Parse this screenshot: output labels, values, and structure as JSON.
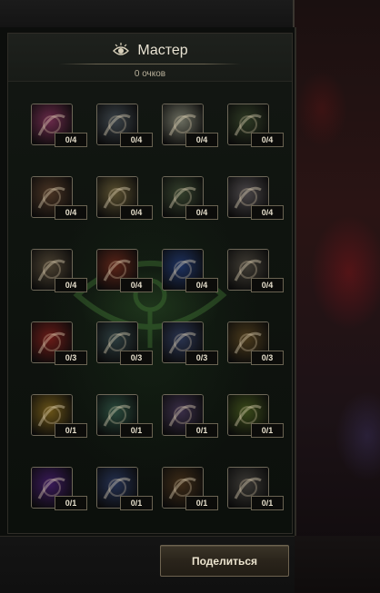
{
  "panel": {
    "title": "Мастер",
    "points_label": "0 очков"
  },
  "skills": [
    {
      "icon": "red-beast-skill-icon",
      "level": "0/4",
      "color": "#6a2a4a"
    },
    {
      "icon": "scattered-shards-skill-icon",
      "level": "0/4",
      "color": "#3a4248"
    },
    {
      "icon": "armored-knight-skill-icon",
      "level": "0/4",
      "color": "#6c6e60"
    },
    {
      "icon": "green-emblem-skill-icon",
      "level": "0/4",
      "color": "#2e3a24"
    },
    {
      "icon": "spear-thrust-skill-icon",
      "level": "0/4",
      "color": "#4a3424"
    },
    {
      "icon": "golden-strike-skill-icon",
      "level": "0/4",
      "color": "#5a5030"
    },
    {
      "icon": "forest-spirit-skill-icon",
      "level": "0/4",
      "color": "#34402c"
    },
    {
      "icon": "shield-sword-skill-icon",
      "level": "0/4",
      "color": "#4a4648"
    },
    {
      "icon": "bronze-cross-rune-skill-icon",
      "level": "0/4",
      "color": "#4a4030"
    },
    {
      "icon": "crimson-rune-skill-icon",
      "level": "0/4",
      "color": "#5a2418"
    },
    {
      "icon": "blue-red-sigil-skill-icon",
      "level": "0/4",
      "color": "#1e3260"
    },
    {
      "icon": "clover-seal-skill-icon",
      "level": "0/4",
      "color": "#403c34"
    },
    {
      "icon": "red-slash-skill-icon",
      "level": "0/3",
      "color": "#6a1c18"
    },
    {
      "icon": "whirlwind-skill-icon",
      "level": "0/3",
      "color": "#2c3c3e"
    },
    {
      "icon": "blade-throw-skill-icon",
      "level": "0/3",
      "color": "#2a3450"
    },
    {
      "icon": "golden-aura-skill-icon",
      "level": "0/3",
      "color": "#4a3a1c"
    },
    {
      "icon": "golden-pillars-skill-icon",
      "level": "0/1",
      "color": "#6a5418"
    },
    {
      "icon": "green-shield-skill-icon",
      "level": "0/1",
      "color": "#2a4a3c"
    },
    {
      "icon": "red-cross-skill-icon",
      "level": "0/1",
      "color": "#3a2e48"
    },
    {
      "icon": "glowing-warrior-skill-icon",
      "level": "0/1",
      "color": "#3a4a1a"
    },
    {
      "icon": "violet-flame-skill-icon",
      "level": "0/1",
      "color": "#3a1a5a"
    },
    {
      "icon": "blue-hex-shield-skill-icon",
      "level": "0/1",
      "color": "#243050"
    },
    {
      "icon": "dark-orb-skill-icon",
      "level": "0/1",
      "color": "#3e2c18"
    },
    {
      "icon": "stone-seal-skill-icon",
      "level": "0/1",
      "color": "#3a3834"
    }
  ],
  "actions": {
    "share_label": "Поделиться"
  }
}
